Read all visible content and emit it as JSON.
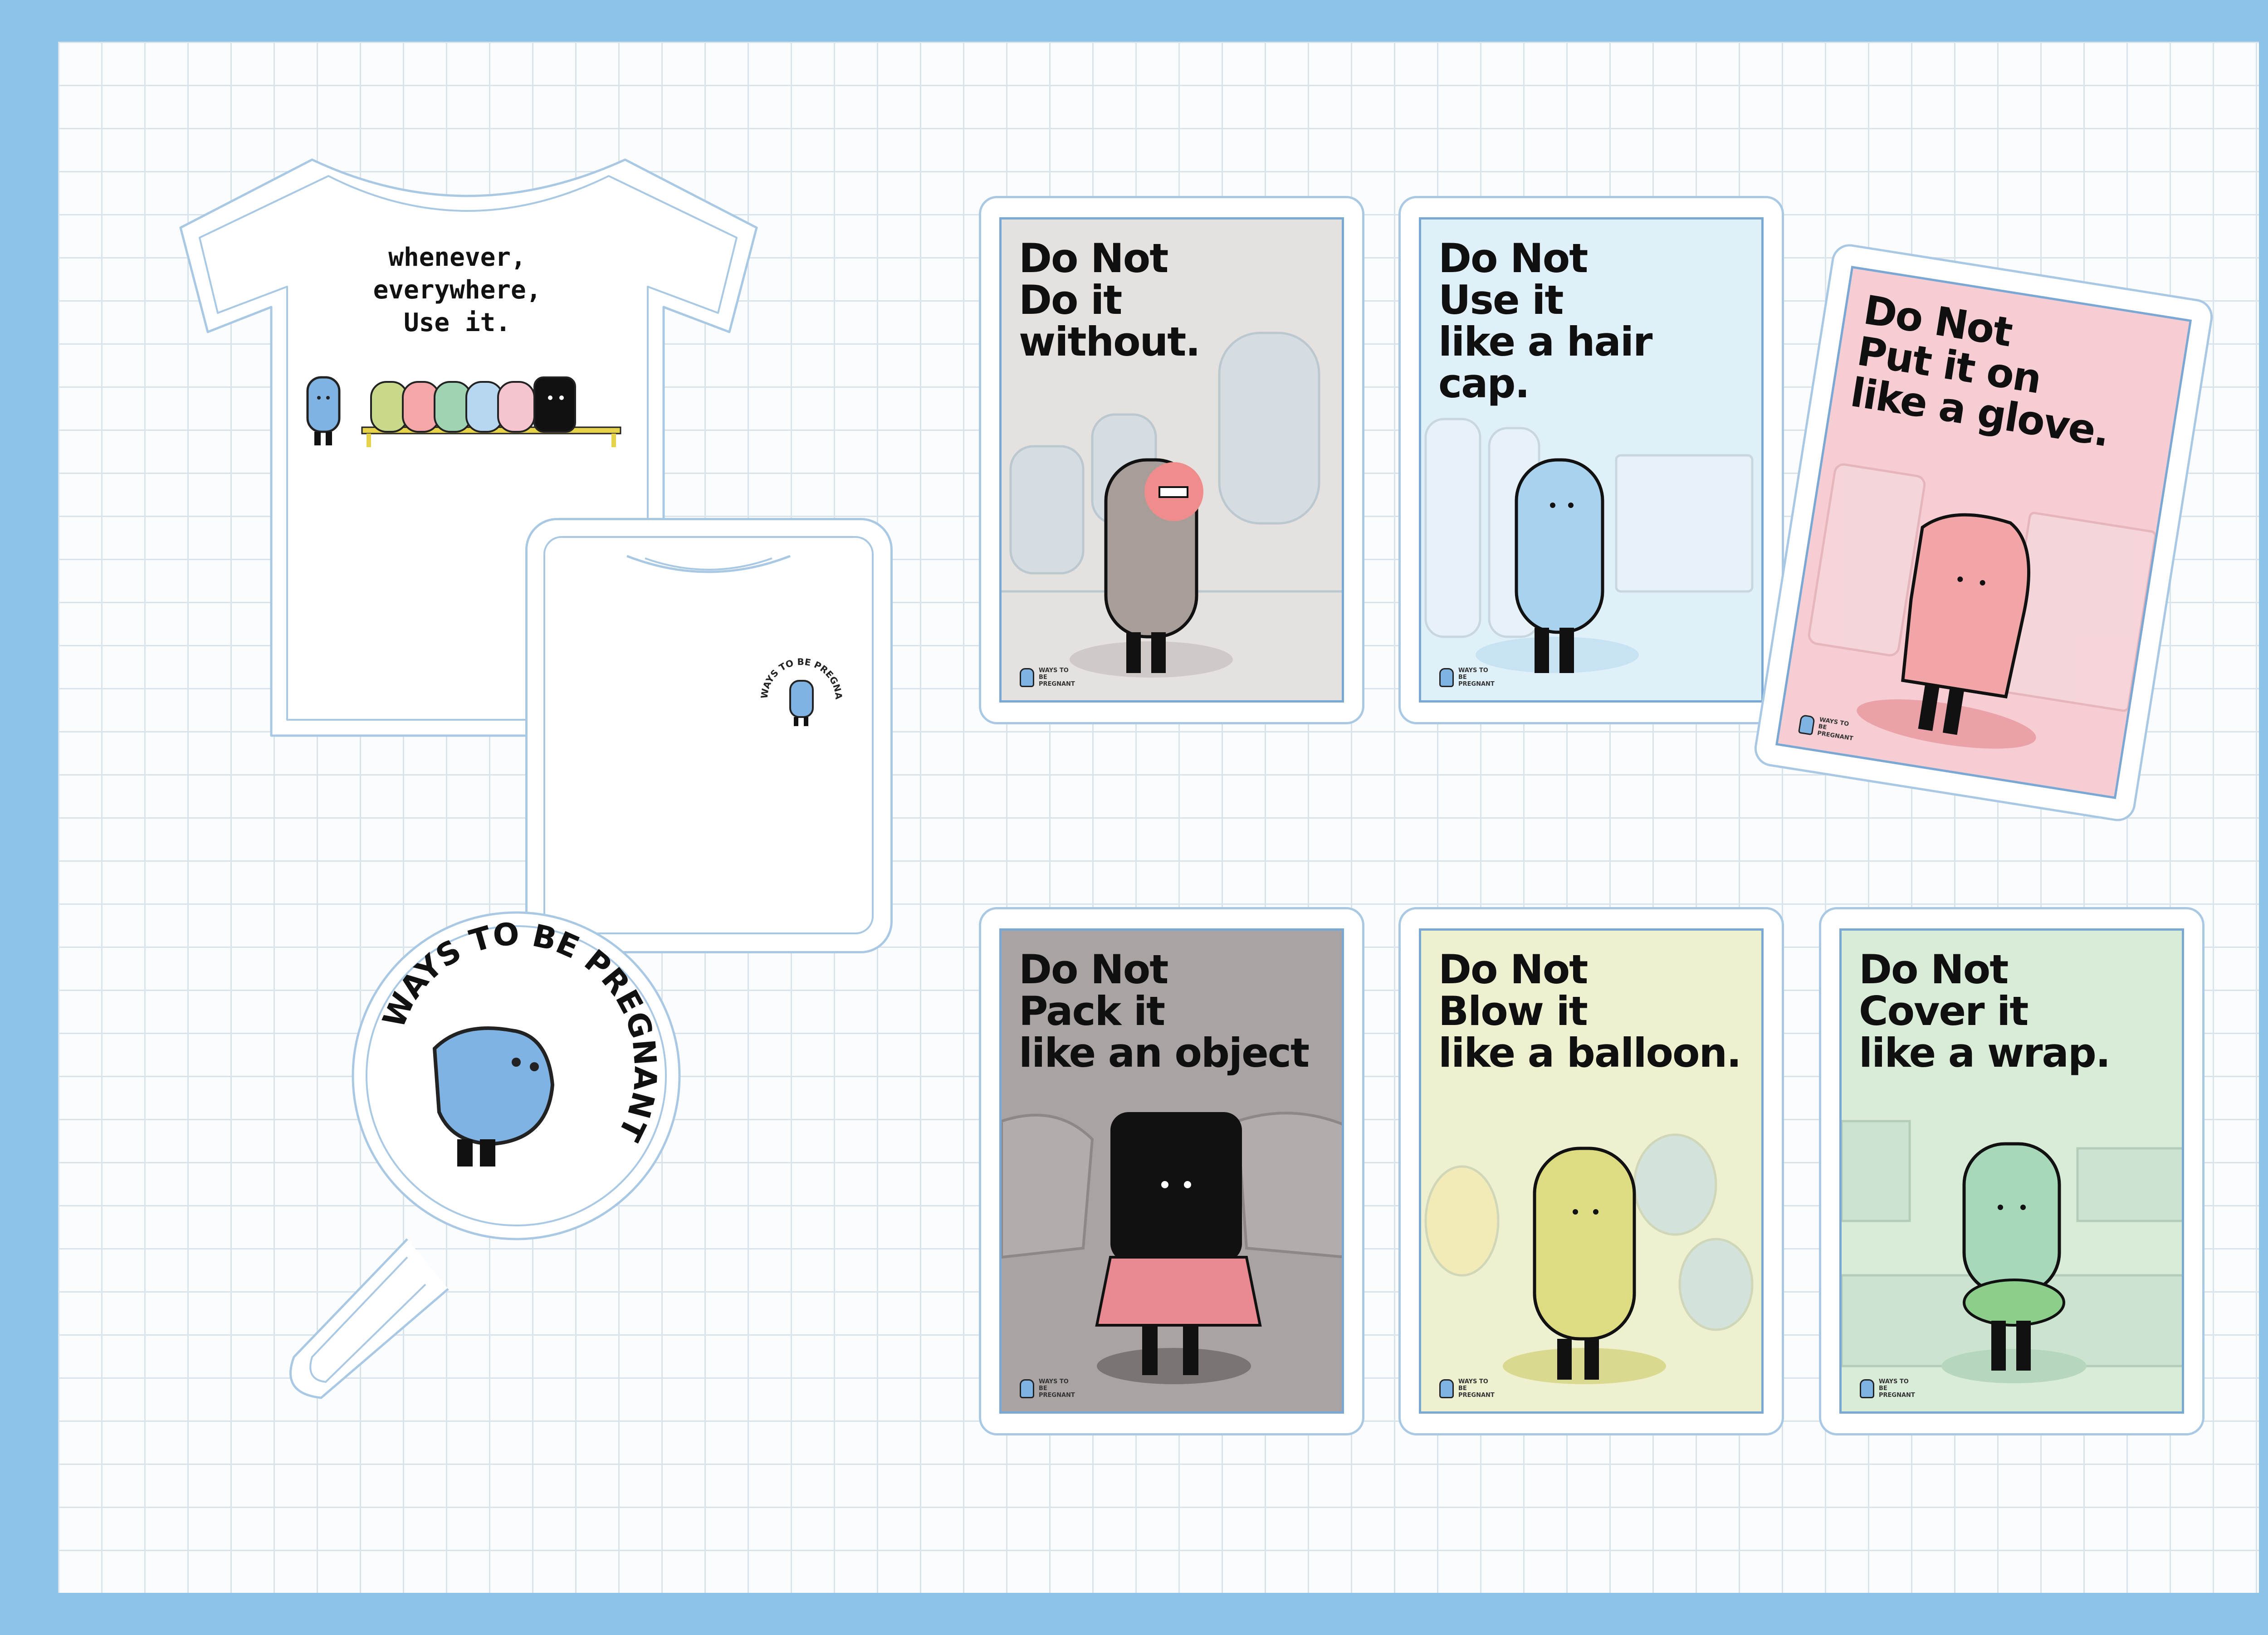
{
  "tshirt_back": {
    "slogan": [
      "whenever,",
      "everywhere,",
      "Use it."
    ]
  },
  "tshirt_front": {
    "badge_text": "WAYS TO BE PREGNANT"
  },
  "sticker": {
    "text": "WAYS TO BE PREGNANT"
  },
  "cards": [
    {
      "lines": [
        "Do Not",
        "Do it",
        "without."
      ],
      "bg": "#e4e1df",
      "char": "#a79e9a",
      "brand": "WAYS TO BE PREGNANT"
    },
    {
      "lines": [
        "Do Not",
        "Use it",
        "like a hair cap."
      ],
      "bg": "#dff0f8",
      "char": "#a9d2ef",
      "brand": "WAYS TO BE PREGNANT"
    },
    {
      "lines": [
        "Do Not",
        "Put it on",
        "like a glove."
      ],
      "bg": "#f6cdd3",
      "char": "#f1a5a7",
      "brand": "WAYS TO BE PREGNANT"
    },
    {
      "lines": [
        "Do Not",
        "Pack it",
        "like an object"
      ],
      "bg": "#a9a3a3",
      "char": "#111111",
      "brand": "WAYS TO BE PREGNANT"
    },
    {
      "lines": [
        "Do Not",
        "Blow it",
        "like a balloon."
      ],
      "bg": "#eef0cf",
      "char": "#dedc80",
      "brand": "WAYS TO BE PREGNANT"
    },
    {
      "lines": [
        "Do Not",
        "Cover it",
        "like a wrap."
      ],
      "bg": "#d8ecd8",
      "char": "#a6d8b9",
      "brand": "WAYS TO BE PREGNANT"
    }
  ],
  "colors": {
    "frame": "#8ec3e8",
    "outline": "#a9c8e3",
    "mascot": "#7eb3e3"
  }
}
